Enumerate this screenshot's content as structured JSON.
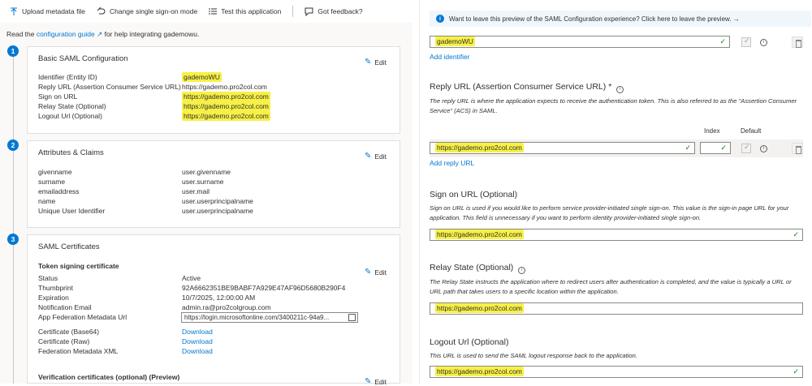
{
  "toolbar": {
    "upload": "Upload metadata file",
    "change": "Change single sign-on mode",
    "test": "Test this application",
    "feedback": "Got feedback?"
  },
  "intro": {
    "prefix": "Read the",
    "link": "configuration guide",
    "suffix": "for help integrating gademowu."
  },
  "steps": [
    "1",
    "2",
    "3"
  ],
  "edit_label": "Edit",
  "basic_saml": {
    "title": "Basic SAML Configuration",
    "rows": [
      {
        "label": "Identifier (Entity ID)",
        "value": "gademoWU"
      },
      {
        "label": "Reply URL (Assertion Consumer Service URL)",
        "value": "https://gademo.pro2col.com"
      },
      {
        "label": "Sign on URL",
        "value": "https://gademo.pro2col.com"
      },
      {
        "label": "Relay State (Optional)",
        "value": "https://gademo.pro2col.com"
      },
      {
        "label": "Logout Url (Optional)",
        "value": "https://gademo.pro2col.com"
      }
    ]
  },
  "attributes": {
    "title": "Attributes & Claims",
    "rows": [
      {
        "label": "givenname",
        "value": "user.givenname"
      },
      {
        "label": "surname",
        "value": "user.surname"
      },
      {
        "label": "emailaddress",
        "value": "user.mail"
      },
      {
        "label": "name",
        "value": "user.userprincipalname"
      },
      {
        "label": "Unique User Identifier",
        "value": "user.userprincipalname"
      }
    ]
  },
  "certificates": {
    "title": "SAML Certificates",
    "subtitle": "Token signing certificate",
    "status_label": "Status",
    "status": "Active",
    "thumb_label": "Thumbprint",
    "thumb": "92A6662351BE9BABF7A929E47AF96D5680B290F4",
    "exp_label": "Expiration",
    "exp": "10/7/2025, 12:00:00 AM",
    "email_label": "Notification Email",
    "email": "admin.ra@pro2colgroup.com",
    "meta_label": "App Federation Metadata Url",
    "meta": "https://login.microsoftonline.com/3400211c-94a9...",
    "b64_label": "Certificate (Base64)",
    "raw_label": "Certificate (Raw)",
    "xml_label": "Federation Metadata XML",
    "download": "Download",
    "verification": "Verification certificates (optional) (Preview)"
  },
  "right": {
    "banner": "Want to leave this preview of the SAML Configuration experience? Click here to leave the preview. →",
    "identifier_value": "gademoWU",
    "add_identifier": "Add identifier",
    "reply_title": "Reply URL (Assertion Consumer Service URL)",
    "reply_req": "*",
    "reply_desc": "The reply URL is where the application expects to receive the authentication token. This is also referred to as the \"Assertion Consumer Service\" (ACS) in SAML.",
    "index_hdr": "Index",
    "default_hdr": "Default",
    "reply_value": "https://gademo.pro2col.com",
    "add_reply": "Add reply URL",
    "signon_title": "Sign on URL (Optional)",
    "signon_desc": "Sign on URL is used if you would like to perform service provider-initiated single sign-on. This value is the sign-in page URL for your application. This field is unnecessary if you want to perform identity provider-initiated single sign-on.",
    "signon_value": "https://gademo.pro2col.com",
    "relay_title": "Relay State (Optional)",
    "relay_desc": "The Relay State instructs the application where to redirect users after authentication is completed, and the value is typically a URL or URL path that takes users to a specific location within the application.",
    "relay_value": "https://gademo.pro2col.com",
    "logout_title": "Logout Url (Optional)",
    "logout_desc": "This URL is used to send the SAML logout response back to the application.",
    "logout_value": "https://gademo.pro2col.com"
  },
  "colors": {
    "accent": "#0078d4",
    "highlight": "#f7f046",
    "success": "#107c10"
  }
}
